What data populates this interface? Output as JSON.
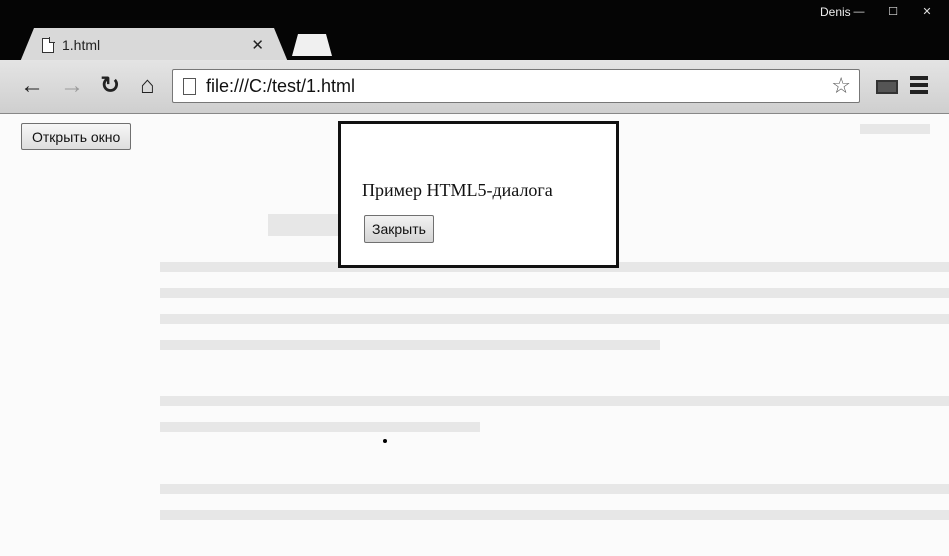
{
  "window": {
    "user_name": "Denis",
    "controls": {
      "minimize": "—",
      "maximize": "☐",
      "close": "✕"
    }
  },
  "tab": {
    "title": "1.html",
    "close_glyph": "✕"
  },
  "toolbar": {
    "back_glyph": "←",
    "forward_glyph": "→",
    "reload_glyph": "↻",
    "home_glyph": "⌂",
    "url": "file:///C:/test/1.html",
    "star_glyph": "☆"
  },
  "page": {
    "open_button_label": "Открыть окно",
    "dialog": {
      "text": "Пример HTML5-диалога",
      "close_button_label": "Закрыть"
    }
  },
  "icons": {
    "tab_page": "page-icon",
    "omnibox_page": "page-icon",
    "extension": "extension-icon",
    "menu": "hamburger-menu-icon"
  }
}
